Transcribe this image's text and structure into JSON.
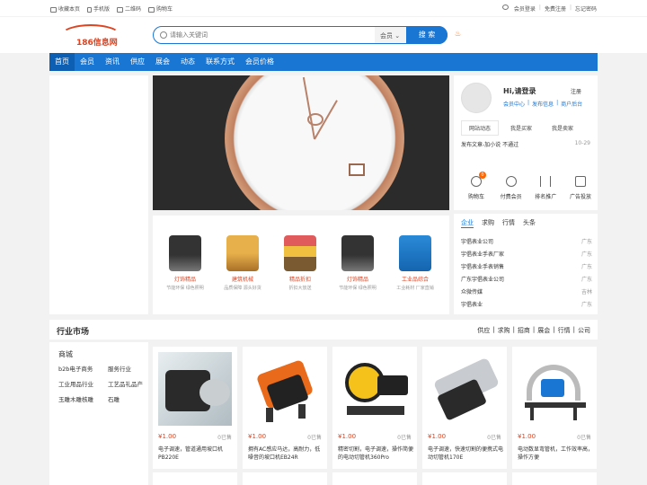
{
  "topbar": {
    "left": [
      "收藏本页",
      "手机版",
      "二维码",
      "购物车"
    ],
    "right": [
      "会员登录",
      "免费注册",
      "忘记密码"
    ]
  },
  "logo": {
    "text": "186信息网"
  },
  "search": {
    "placeholder": "请输入关键词",
    "category": "会员",
    "button": "搜 索"
  },
  "nav": [
    "首页",
    "会员",
    "资讯",
    "供应",
    "展会",
    "动态",
    "联系方式",
    "会员价格"
  ],
  "promo": [
    {
      "title": "灯饰精品",
      "sub": "节能环保 绿色照明"
    },
    {
      "title": "建筑机械",
      "sub": "品质保障 源头好货"
    },
    {
      "title": "精品折扣",
      "sub": "折扣大放送"
    },
    {
      "title": "灯饰精品",
      "sub": "节能环保 绿色照明"
    },
    {
      "title": "工业品综合",
      "sub": "工业耗材 厂家直销"
    }
  ],
  "user": {
    "greeting": "Hi,请登录",
    "register": "注册",
    "links": [
      "会员中心",
      "发布信息",
      "商户后台"
    ],
    "tabs": [
      "网站动态",
      "我是买家",
      "我是卖家"
    ],
    "news": {
      "text": "发布文章-加小说 不通过",
      "date": "10-29"
    },
    "icons": [
      "购物车",
      "付费会员",
      "排名推广",
      "广告投放"
    ],
    "cart_count": "0"
  },
  "news": {
    "tabs": [
      "企业",
      "求购",
      "行情",
      "头条"
    ],
    "rows": [
      {
        "name": "宇倡表业公司",
        "region": "广东"
      },
      {
        "name": "宇倡表业手表厂家",
        "region": "广东"
      },
      {
        "name": "宇倡表业手表销售",
        "region": "广东"
      },
      {
        "name": "广东宇倡表业公司",
        "region": "广东"
      },
      {
        "name": "众微传媒",
        "region": "吉林"
      },
      {
        "name": "宇倡表业",
        "region": "广东"
      }
    ]
  },
  "market": {
    "title": "行业市场",
    "links": [
      "供应",
      "求购",
      "招商",
      "展会",
      "行情",
      "公司"
    ],
    "category_title": "商城",
    "categories": [
      "b2b电子商务",
      "服务行业",
      "工业用品行业",
      "工艺品礼品产",
      "玉雕木雕核雕",
      "石雕"
    ]
  },
  "products": [
    {
      "price": "¥1.00",
      "sold": "0已售",
      "name": "电子调速，管道通用坡口机PB220E"
    },
    {
      "price": "¥1.00",
      "sold": "0已售",
      "name": "拥有AC感应马达，高耐力，低噪音的坡口机EB24R"
    },
    {
      "price": "¥1.00",
      "sold": "0已售",
      "name": "精密切割，电子调速，操作简便的电动切管机360Pro"
    },
    {
      "price": "¥1.00",
      "sold": "0已售",
      "name": "电子调速，快速切割的便携式电动切管机170E"
    },
    {
      "price": "¥1.00",
      "sold": "0已售",
      "name": "电动数显弯管机，工作效率高，操作方便"
    }
  ],
  "colors": {
    "brand": "#1976d2",
    "accent": "#dd4422"
  }
}
